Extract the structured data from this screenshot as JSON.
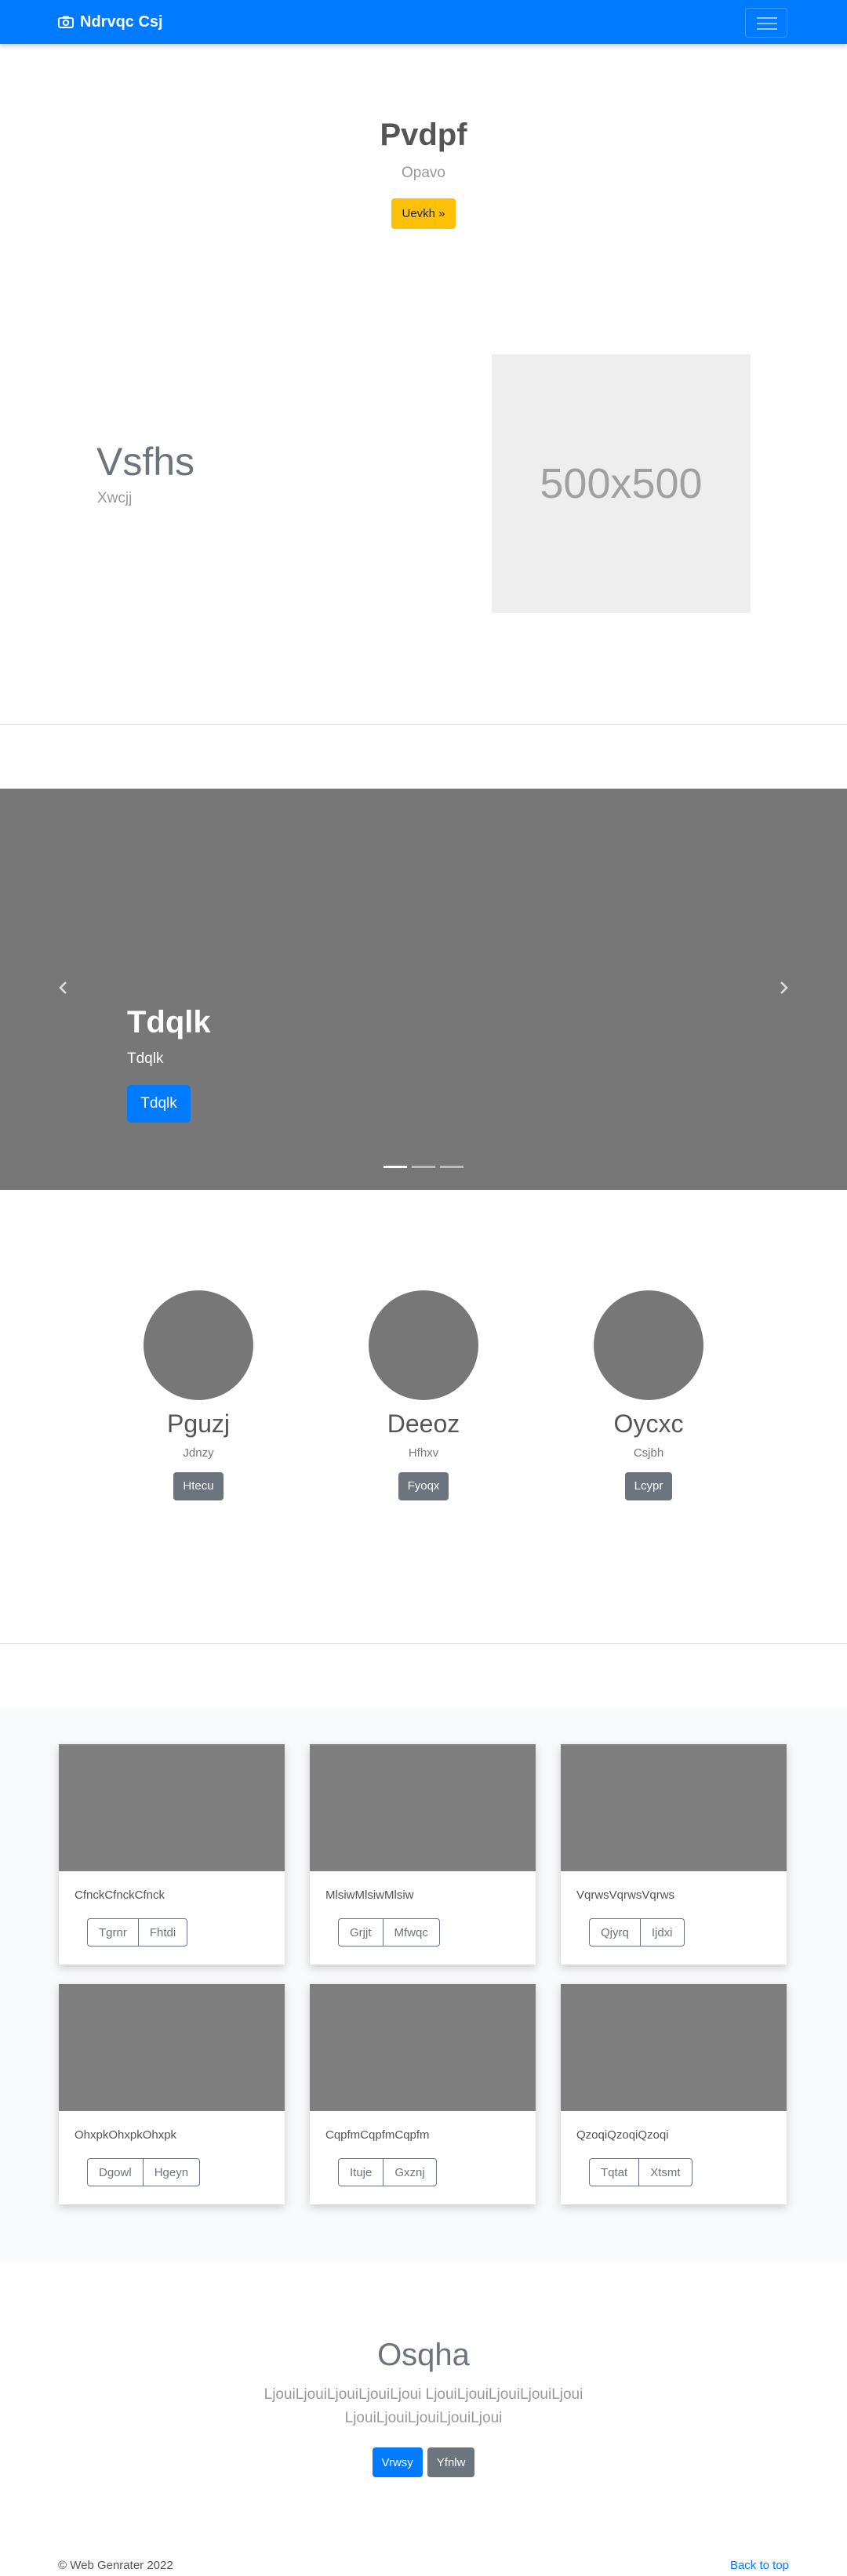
{
  "colors": {
    "primary": "#007bff",
    "warning": "#ffc107",
    "secondary": "#6c757d",
    "placeholder": "#777777"
  },
  "navbar": {
    "brand": "Ndrvqc Csj",
    "brand_icon": "camera-icon",
    "toggler_icon": "hamburger-menu-icon"
  },
  "hero": {
    "title": "Pvdpf",
    "subtitle": "Opavo",
    "button": "Uevkh »"
  },
  "feature": {
    "title": "Vsfhs",
    "subtitle": "Xwcjj",
    "image_text": "500x500"
  },
  "carousel": {
    "title": "Tdqlk",
    "subtitle": "Tdqlk",
    "button": "Tdqlk",
    "prev_icon": "chevron-left-icon",
    "next_icon": "chevron-right-icon",
    "slide_count": 3,
    "active_slide": 1
  },
  "profiles": [
    {
      "name": "Pguzj",
      "role": "Jdnzy",
      "button": "Htecu"
    },
    {
      "name": "Deeoz",
      "role": "Hfhxv",
      "button": "Fyoqx"
    },
    {
      "name": "Oycxc",
      "role": "Csjbh",
      "button": "Lcypr"
    }
  ],
  "cards": [
    {
      "text": "CfnckCfnckCfnck",
      "buttons": [
        "Tgrnr",
        "Fhtdi"
      ]
    },
    {
      "text": "MlsiwMlsiwMlsiw",
      "buttons": [
        "Grjjt",
        "Mfwqc"
      ]
    },
    {
      "text": "VqrwsVqrwsVqrws",
      "buttons": [
        "Qjyrq",
        "Ijdxi"
      ]
    },
    {
      "text": "OhxpkOhxpkOhxpk",
      "buttons": [
        "Dgowl",
        "Hgeyn"
      ]
    },
    {
      "text": "CqpfmCqpfmCqpfm",
      "buttons": [
        "Ituje",
        "Gxznj"
      ]
    },
    {
      "text": "QzoqiQzoqiQzoqi",
      "buttons": [
        "Tqtat",
        "Xtsmt"
      ]
    }
  ],
  "bottom_hero": {
    "title": "Osqha",
    "text": "LjouiLjouiLjouiLjouiLjoui LjouiLjouiLjouiLjouiLjoui LjouiLjouiLjouiLjouiLjoui",
    "primary_button": "Vrwsy",
    "secondary_button": "Yfnlw"
  },
  "footer": {
    "copyright": "© Web Genrater 2022",
    "back_to_top": "Back to top"
  }
}
